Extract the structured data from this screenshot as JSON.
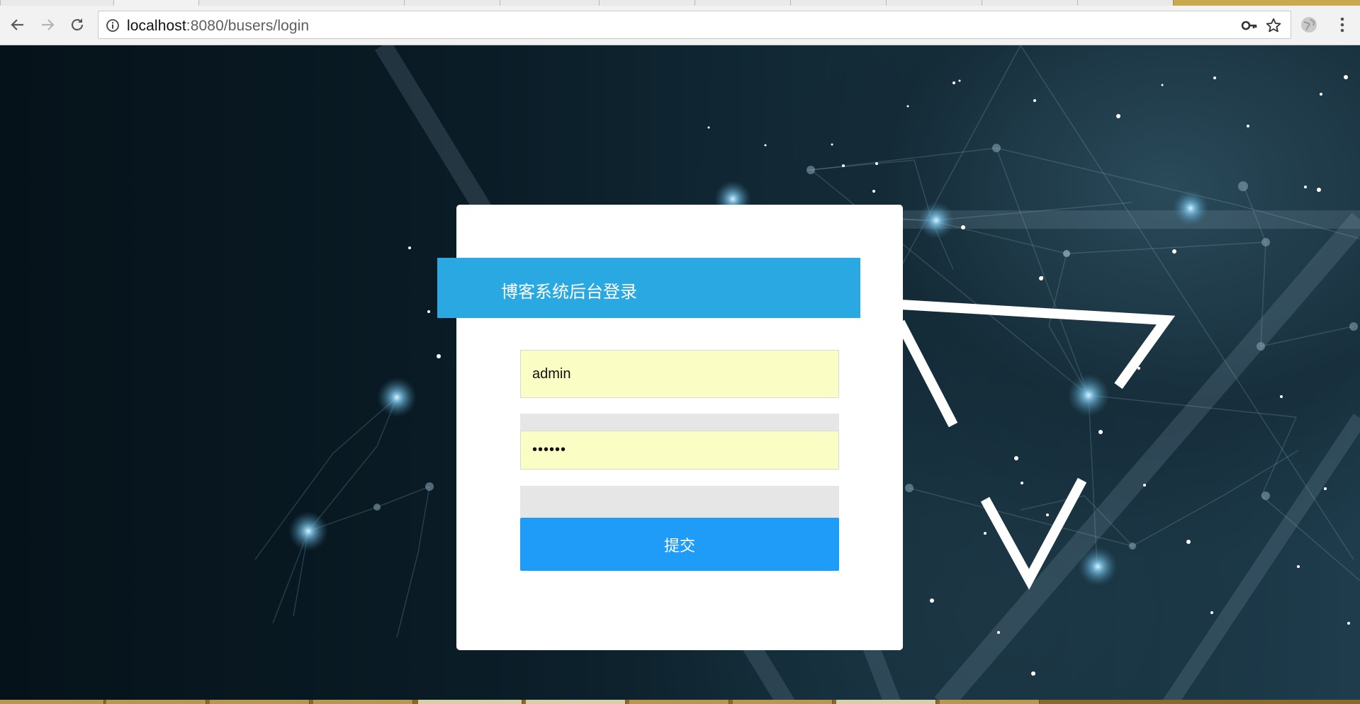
{
  "browser": {
    "url_host": "localhost",
    "url_rest": ":8080/busers/login"
  },
  "login": {
    "title": "博客系统后台登录",
    "username_value": "admin",
    "password_mask": "••••••",
    "submit_label": "提交"
  },
  "icons": {
    "back": "arrow-left",
    "forward": "arrow-right",
    "reload": "reload",
    "info": "info-circle",
    "key": "key",
    "star": "star",
    "extension": "globe",
    "menu": "vertical-dots"
  },
  "colors": {
    "banner": "#29a8e1",
    "submit": "#1e9cf7",
    "autofill": "#fafdc4"
  }
}
